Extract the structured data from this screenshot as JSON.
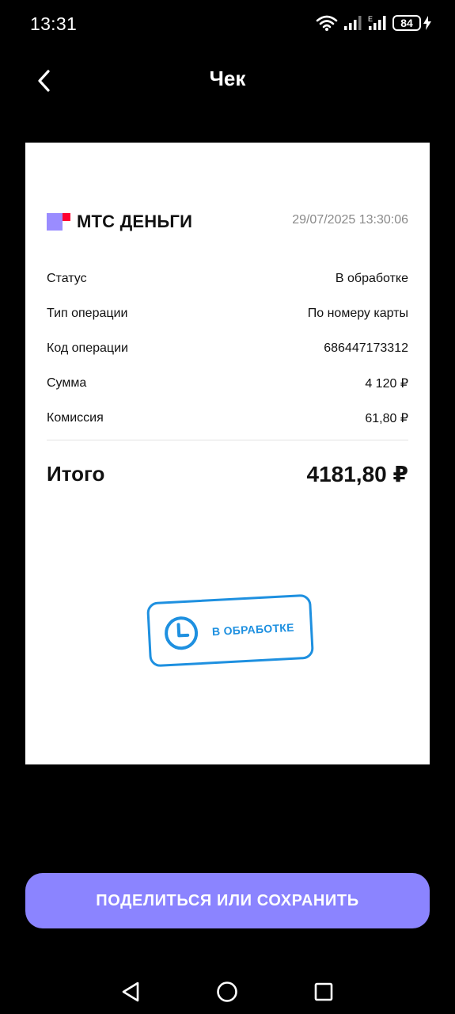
{
  "status_bar": {
    "time": "13:31",
    "network_label": "E",
    "battery": "84",
    "icons": [
      "wifi-icon",
      "signal-icon",
      "signal-icon",
      "battery-icon",
      "charging-icon"
    ]
  },
  "header": {
    "title": "Чек",
    "back_icon": "chevron-left-icon"
  },
  "receipt": {
    "brand": "МТС ДЕНЬГИ",
    "date": "29/07/2025 13:30:06",
    "rows": [
      {
        "label": "Статус",
        "value": "В обработке"
      },
      {
        "label": "Тип операции",
        "value": "По номеру карты"
      },
      {
        "label": "Код операции",
        "value": "686447173312"
      },
      {
        "label": "Сумма",
        "value": "4 120 ₽"
      },
      {
        "label": "Комиссия",
        "value": "61,80 ₽"
      }
    ],
    "total_label": "Итого",
    "total_value": "4181,80 ₽",
    "stamp_text": "В ОБРАБОТКЕ"
  },
  "actions": {
    "share_label": "ПОДЕЛИТЬСЯ ИЛИ СОХРАНИТЬ"
  },
  "colors": {
    "accent": "#8b84ff",
    "brand_violet": "#9a8cff",
    "brand_red": "#ff0032",
    "stamp_blue": "#1e90e0",
    "background": "#000000",
    "card": "#ffffff"
  },
  "nav_bar": {
    "icons": [
      "back-triangle-icon",
      "home-circle-icon",
      "recents-square-icon"
    ]
  }
}
